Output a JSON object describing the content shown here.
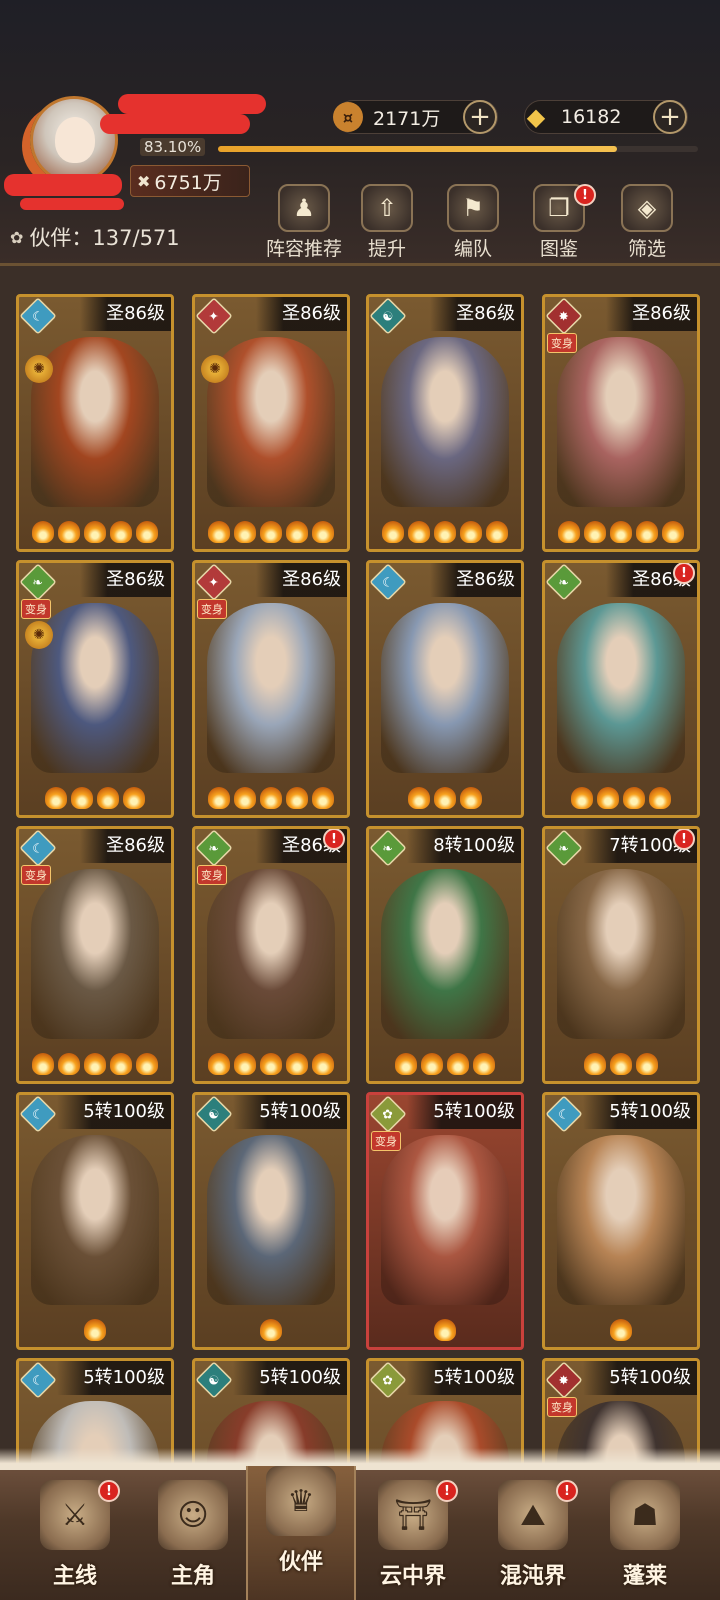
{
  "header": {
    "exp_percent_text": "83.10%",
    "exp_fraction": 0.831,
    "power_value": "6751万",
    "currencies": [
      {
        "name": "copper-coin",
        "value": "2171万",
        "icon": "¤",
        "color": "#c9822e"
      },
      {
        "name": "gold-ingot",
        "value": "16182",
        "icon": "◆",
        "color": "#f2c54a"
      }
    ],
    "partner_label": "伙伴：137/571",
    "buttons": [
      {
        "id": "lineup",
        "label": "阵容推荐",
        "icon": "♟",
        "alert": false
      },
      {
        "id": "upgrade",
        "label": "提升",
        "icon": "⇧",
        "alert": false
      },
      {
        "id": "formation",
        "label": "编队",
        "icon": "⚑",
        "alert": false
      },
      {
        "id": "codex",
        "label": "图鉴",
        "icon": "❐",
        "alert": true
      },
      {
        "id": "filter",
        "label": "筛选",
        "icon": "◈",
        "alert": false
      }
    ]
  },
  "cards": [
    {
      "level": "圣86级",
      "elem_color": "#3f9bbf",
      "elem_glyph": "☾",
      "flames": 5,
      "transform": false,
      "badge": true,
      "alert": false,
      "tint": "#a8451f"
    },
    {
      "level": "圣86级",
      "elem_color": "#b23a3a",
      "elem_glyph": "✦",
      "flames": 5,
      "transform": false,
      "badge": true,
      "alert": false,
      "tint": "#b6502c"
    },
    {
      "level": "圣86级",
      "elem_color": "#2c7f7c",
      "elem_glyph": "☯",
      "flames": 5,
      "transform": false,
      "badge": false,
      "alert": false,
      "tint": "#6a6a8a"
    },
    {
      "level": "圣86级",
      "elem_color": "#a23030",
      "elem_glyph": "✸",
      "flames": 5,
      "transform": true,
      "badge": false,
      "alert": false,
      "tint": "#b06666"
    },
    {
      "level": "圣86级",
      "elem_color": "#5a9a3a",
      "elem_glyph": "❧",
      "flames": 4,
      "transform": true,
      "badge": true,
      "alert": false,
      "tint": "#4a5a88"
    },
    {
      "level": "圣86级",
      "elem_color": "#b23a3a",
      "elem_glyph": "✦",
      "flames": 5,
      "transform": true,
      "badge": false,
      "alert": false,
      "tint": "#9fb0c8"
    },
    {
      "level": "圣86级",
      "elem_color": "#3f9bbf",
      "elem_glyph": "☾",
      "flames": 3,
      "transform": false,
      "badge": false,
      "alert": false,
      "tint": "#8aa0c0"
    },
    {
      "level": "圣86级",
      "elem_color": "#5a9a3a",
      "elem_glyph": "❧",
      "flames": 4,
      "transform": false,
      "badge": false,
      "alert": true,
      "tint": "#5aa0a0"
    },
    {
      "level": "圣86级",
      "elem_color": "#3f9bbf",
      "elem_glyph": "☾",
      "flames": 5,
      "transform": true,
      "badge": false,
      "alert": false,
      "tint": "#6a5a48"
    },
    {
      "level": "圣86级",
      "elem_color": "#5a9a3a",
      "elem_glyph": "❧",
      "flames": 5,
      "transform": true,
      "badge": false,
      "alert": true,
      "tint": "#6a4a3a"
    },
    {
      "level": "8转100级",
      "elem_color": "#5a9a3a",
      "elem_glyph": "❧",
      "flames": 4,
      "transform": false,
      "badge": false,
      "alert": false,
      "tint": "#3a7a4a"
    },
    {
      "level": "7转100级",
      "elem_color": "#5a9a3a",
      "elem_glyph": "❧",
      "flames": 3,
      "transform": false,
      "badge": false,
      "alert": true,
      "tint": "#8a6a4a"
    },
    {
      "level": "5转100级",
      "elem_color": "#3f9bbf",
      "elem_glyph": "☾",
      "flames": 1,
      "transform": false,
      "badge": false,
      "alert": false,
      "tint": "#6a5038"
    },
    {
      "level": "5转100级",
      "elem_color": "#2c7f7c",
      "elem_glyph": "☯",
      "flames": 1,
      "transform": false,
      "badge": false,
      "alert": false,
      "tint": "#5a6a80"
    },
    {
      "level": "5转100级",
      "elem_color": "#8a9a3a",
      "elem_glyph": "✿",
      "flames": 1,
      "transform": true,
      "badge": false,
      "alert": false,
      "tint": "#b05a44",
      "red": true
    },
    {
      "level": "5转100级",
      "elem_color": "#3f9bbf",
      "elem_glyph": "☾",
      "flames": 1,
      "transform": false,
      "badge": false,
      "alert": false,
      "tint": "#c08a5a"
    },
    {
      "level": "5转100级",
      "elem_color": "#3f9bbf",
      "elem_glyph": "☾",
      "flames": 0,
      "transform": false,
      "badge": false,
      "alert": false,
      "tint": "#c8c8c8"
    },
    {
      "level": "5转100级",
      "elem_color": "#2c7f7c",
      "elem_glyph": "☯",
      "flames": 0,
      "transform": false,
      "badge": false,
      "alert": false,
      "tint": "#8a3a2a"
    },
    {
      "level": "5转100级",
      "elem_color": "#8a9a3a",
      "elem_glyph": "✿",
      "flames": 0,
      "transform": false,
      "badge": false,
      "alert": false,
      "tint": "#b04a2a"
    },
    {
      "level": "5转100级",
      "elem_color": "#a23030",
      "elem_glyph": "✸",
      "flames": 0,
      "transform": true,
      "badge": false,
      "alert": false,
      "tint": "#3a3030"
    }
  ],
  "transform_tag": "变身",
  "nav": [
    {
      "id": "main-line",
      "label": "主线",
      "icon": "⚔",
      "alert": true,
      "active": false
    },
    {
      "id": "protagonist",
      "label": "主角",
      "icon": "☺",
      "alert": false,
      "active": false
    },
    {
      "id": "partner",
      "label": "伙伴",
      "icon": "♛",
      "alert": false,
      "active": true
    },
    {
      "id": "cloud-realm",
      "label": "云中界",
      "icon": "⛩",
      "alert": true,
      "active": false
    },
    {
      "id": "chaos-realm",
      "label": "混沌界",
      "icon": "⛰",
      "alert": true,
      "active": false
    },
    {
      "id": "penglai",
      "label": "蓬莱",
      "icon": "☗",
      "alert": false,
      "active": false
    }
  ]
}
